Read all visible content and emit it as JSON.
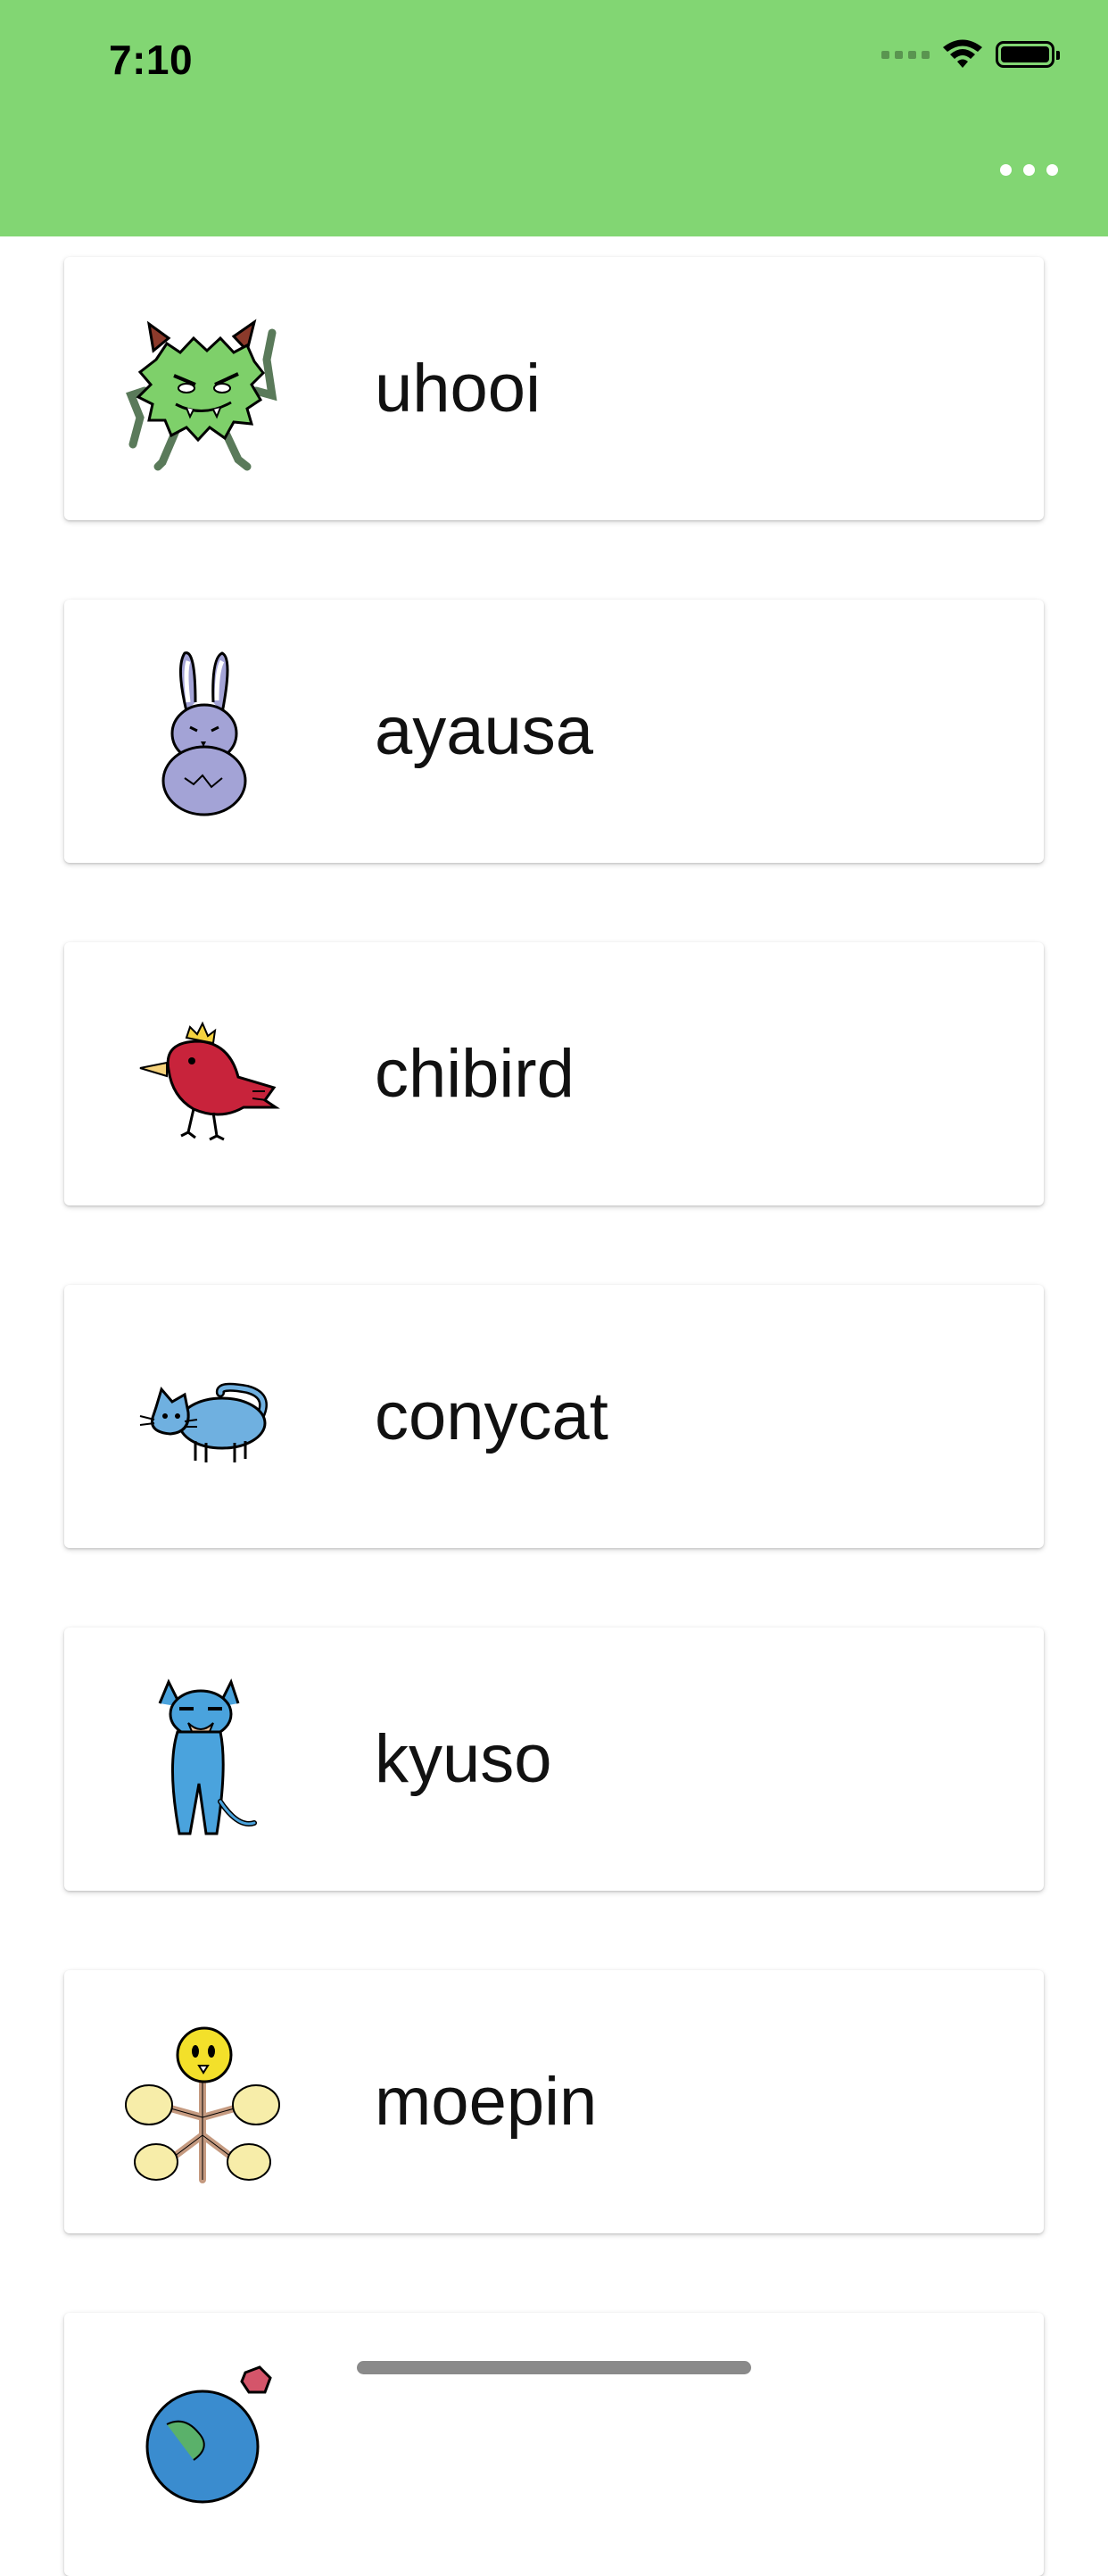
{
  "status_bar": {
    "time": "7:10",
    "icons": [
      "cellular-signal-icon",
      "wifi-icon",
      "battery-icon"
    ]
  },
  "app_bar": {
    "background": "#82d673",
    "more_icon": "more-horizontal-icon"
  },
  "characters": [
    {
      "name": "uhooi",
      "icon": "green-horned-monster-icon"
    },
    {
      "name": "ayausa",
      "icon": "purple-rabbit-icon"
    },
    {
      "name": "chibird",
      "icon": "red-bird-icon"
    },
    {
      "name": "conycat",
      "icon": "blue-cat-icon"
    },
    {
      "name": "kyuso",
      "icon": "blue-mouse-icon"
    },
    {
      "name": "moepin",
      "icon": "yellow-flower-creature-icon"
    },
    {
      "name": "",
      "icon": "blue-planet-creature-icon"
    }
  ]
}
